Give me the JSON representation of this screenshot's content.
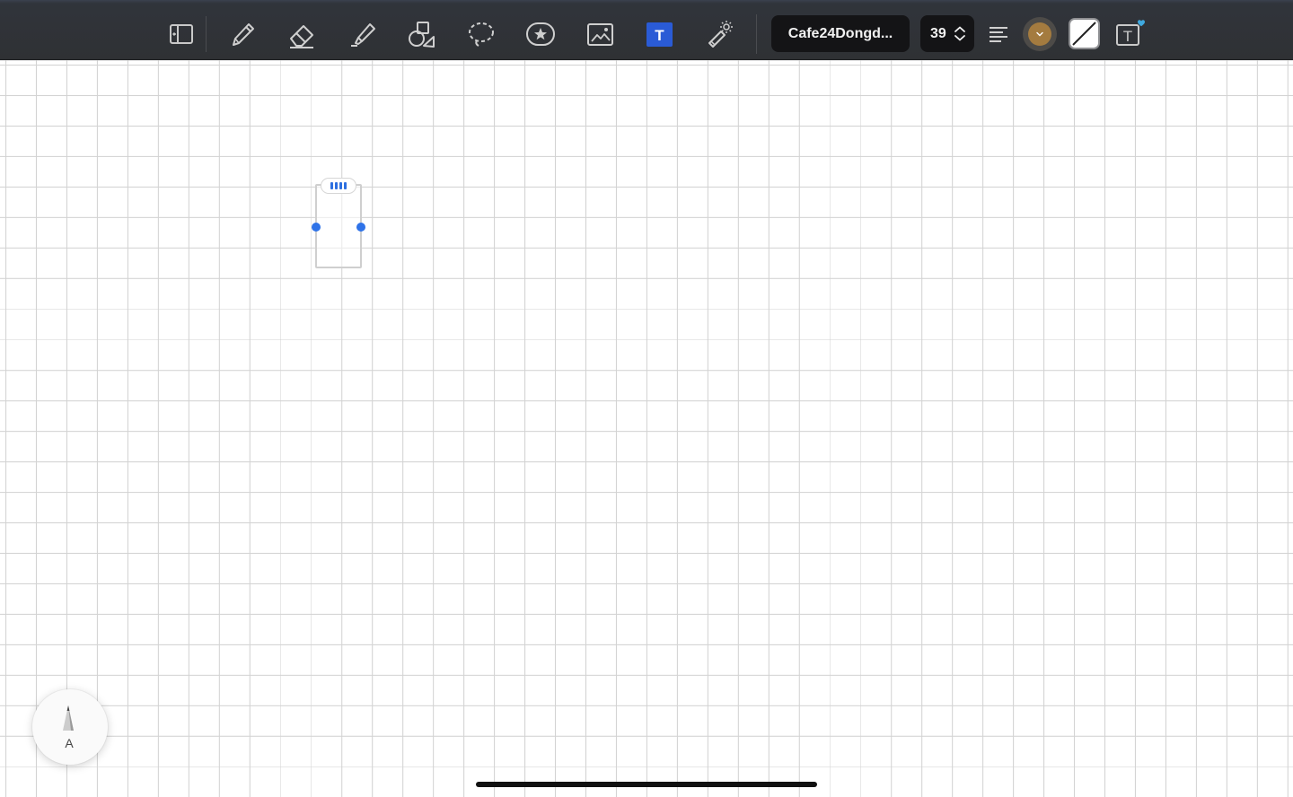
{
  "toolbar": {
    "tools": [
      {
        "name": "sidebar-toggle-icon",
        "active": false
      },
      {
        "name": "pencil-icon",
        "active": false
      },
      {
        "name": "eraser-icon",
        "active": false
      },
      {
        "name": "highlighter-icon",
        "active": false
      },
      {
        "name": "shapes-icon",
        "active": false
      },
      {
        "name": "lasso-icon",
        "active": false
      },
      {
        "name": "sticker-icon",
        "active": false
      },
      {
        "name": "image-icon",
        "active": false
      },
      {
        "name": "text-tool-icon",
        "active": true
      },
      {
        "name": "laser-pointer-icon",
        "active": false
      }
    ],
    "text_tool_label": "T",
    "font_name": "Cafe24Dongd...",
    "font_size": "39",
    "alignment": "align-left-icon",
    "text_color": "#a47b3f",
    "background_color": "none",
    "text_style_button": "T",
    "accent_color": "#2a5bd6",
    "badge_color": "#3fa9e0"
  },
  "canvas": {
    "paper": "grid",
    "grid_color": "#d3d3d3",
    "selection_color": "#2f73e8"
  },
  "pencil_widget": {
    "label": "A"
  }
}
